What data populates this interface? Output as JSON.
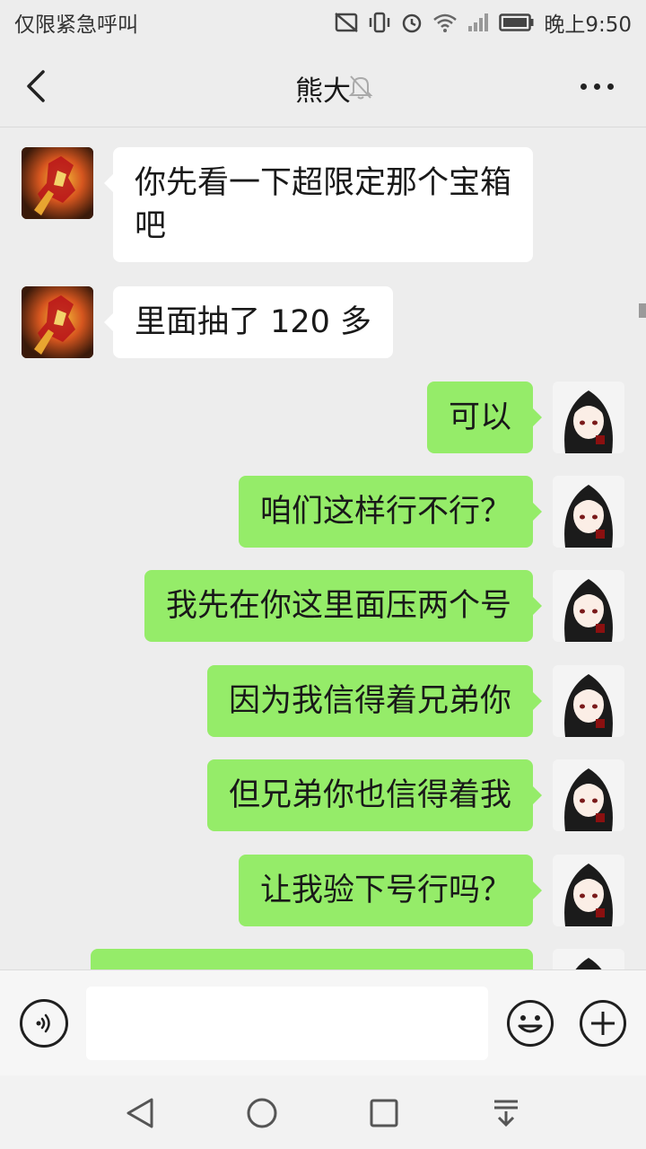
{
  "status_bar": {
    "left_text": "仅限紧急呼叫",
    "time": "晚上9:50",
    "icons": [
      "sim-off-icon",
      "vibrate-icon",
      "alarm-icon",
      "wifi-icon",
      "signal-icon",
      "battery-icon"
    ]
  },
  "header": {
    "title": "熊大",
    "back_icon": "chevron-left-icon",
    "mute_icon": "bell-off-icon",
    "more_icon": "more-icon"
  },
  "messages": [
    {
      "side": "left",
      "text": "你先看一下超限定那个宝箱\n吧"
    },
    {
      "side": "left",
      "text": "里面抽了 120 多"
    },
    {
      "side": "right",
      "text": "可以"
    },
    {
      "side": "right",
      "text": "咱们这样行不行？"
    },
    {
      "side": "right",
      "text": "我先在你这里面压两个号"
    },
    {
      "side": "right",
      "text": "因为我信得着兄弟你"
    },
    {
      "side": "right",
      "text": "但兄弟你也信得着我"
    },
    {
      "side": "right",
      "text": "让我验下号行吗？"
    },
    {
      "side": "right",
      "text": ""
    }
  ],
  "input_bar": {
    "value": "",
    "icons": [
      "voice-icon",
      "emoji-icon",
      "plus-icon"
    ]
  },
  "nav_bar": {
    "icons": [
      "back-triangle-icon",
      "home-circle-icon",
      "recents-square-icon",
      "notification-down-icon"
    ]
  },
  "colors": {
    "background": "#ededed",
    "outgoing_bubble": "#95ec69",
    "incoming_bubble": "#ffffff"
  }
}
